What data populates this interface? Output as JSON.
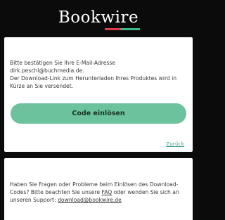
{
  "header": {
    "logo_text": "Bookwire"
  },
  "main_card": {
    "lines": [
      "Bitte bestätigen Sie Ihre E-Mail-Adresse",
      "dirk.peschl@buchmedia.de.",
      "Der Download-Link zum Herunterladen Ihres Produktes wird in",
      "Kürze an Sie versendet."
    ],
    "button_label": "Code einlösen",
    "back_label": "Zurück"
  },
  "support_card": {
    "line1": "Haben Sie Fragen oder Probleme beim Einlösen des Download-",
    "line2_before": "Codes? Bitte beachten Sie unsere ",
    "faq_label": "FAQ",
    "line2_after": " oder wenden Sie sich an",
    "line3_before": "unseren Support: ",
    "support_email": "download@bookwire.de"
  },
  "colors": {
    "accent_green": "#6cc29c",
    "link_teal": "#3e9f8b",
    "logo_red": "#e03b4b",
    "logo_green": "#3fb889"
  }
}
